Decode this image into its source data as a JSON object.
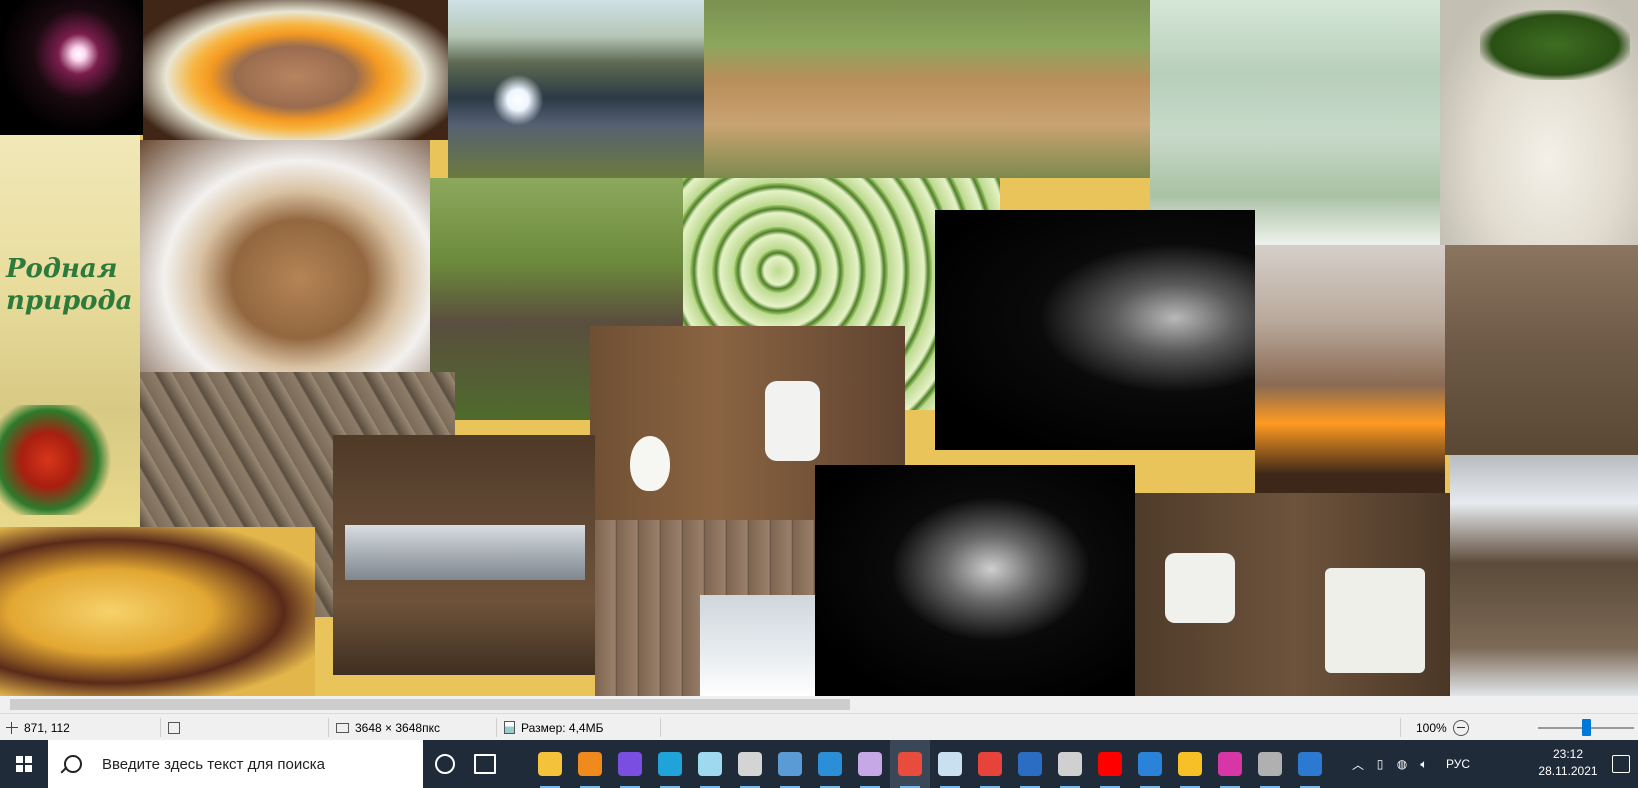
{
  "canvas": {
    "brand_text": "Родная\nприрода",
    "tiles": [
      {
        "name": "fireworks-photo"
      },
      {
        "name": "cake-oranges-photo"
      },
      {
        "name": "covered-pond-photo"
      },
      {
        "name": "seedlings-boxes-photo"
      },
      {
        "name": "fridge-cucumbers-photo"
      },
      {
        "name": "cucumber-sack-photo"
      },
      {
        "name": "rodnaya-priroda-package-photo"
      },
      {
        "name": "cake-slice-photo"
      },
      {
        "name": "compost-mound-photo"
      },
      {
        "name": "sliced-cucumbers-photo"
      },
      {
        "name": "wire-night-photo-1"
      },
      {
        "name": "stove-pot-photo"
      },
      {
        "name": "barn-interior-photo"
      },
      {
        "name": "old-fence-boards-photo"
      },
      {
        "name": "door-hinge-photo"
      },
      {
        "name": "lamp-socket-photo"
      },
      {
        "name": "baked-food-photo"
      },
      {
        "name": "log-wall-snow-photo"
      },
      {
        "name": "wire-night-photo-2"
      },
      {
        "name": "power-outlet-photo"
      },
      {
        "name": "snowy-shed-photo"
      }
    ]
  },
  "statusbar": {
    "cursor_position": "871, 112",
    "selection": "",
    "dimensions": "3648 × 3648пкс",
    "file_size": "Размер: 4,4МБ",
    "zoom": "100%"
  },
  "taskbar": {
    "search_placeholder": "Введите здесь текст для поиска",
    "apps": [
      {
        "name": "file-explorer",
        "color": "#f4c23b"
      },
      {
        "name": "avast",
        "color": "#f08a1c"
      },
      {
        "name": "yandex-browser",
        "color": "#7a4ee0"
      },
      {
        "name": "edge",
        "color": "#1fa3d8"
      },
      {
        "name": "store",
        "color": "#9fd9f0"
      },
      {
        "name": "photos",
        "color": "#d4d4d4"
      },
      {
        "name": "image-viewer",
        "color": "#5b9bd5"
      },
      {
        "name": "internet-explorer",
        "color": "#2b8ed6"
      },
      {
        "name": "paint-3d",
        "color": "#c7a8e6"
      },
      {
        "name": "media-app",
        "color": "#e74c3c"
      },
      {
        "name": "paint",
        "color": "#c8e0f0"
      },
      {
        "name": "chrome",
        "color": "#e8433b"
      },
      {
        "name": "video-editor",
        "color": "#2a6dc2"
      },
      {
        "name": "camera-app",
        "color": "#d0d0d0"
      },
      {
        "name": "youtube",
        "color": "#ff0000"
      },
      {
        "name": "mail-app",
        "color": "#2a83d8"
      },
      {
        "name": "stellarium",
        "color": "#f7c026"
      },
      {
        "name": "drop-app",
        "color": "#d636a6"
      },
      {
        "name": "car-app",
        "color": "#b0b0b0"
      },
      {
        "name": "help-app",
        "color": "#2b79d0"
      }
    ],
    "tray": {
      "language": "РУС",
      "time": "23:12",
      "date": "28.11.2021"
    }
  }
}
